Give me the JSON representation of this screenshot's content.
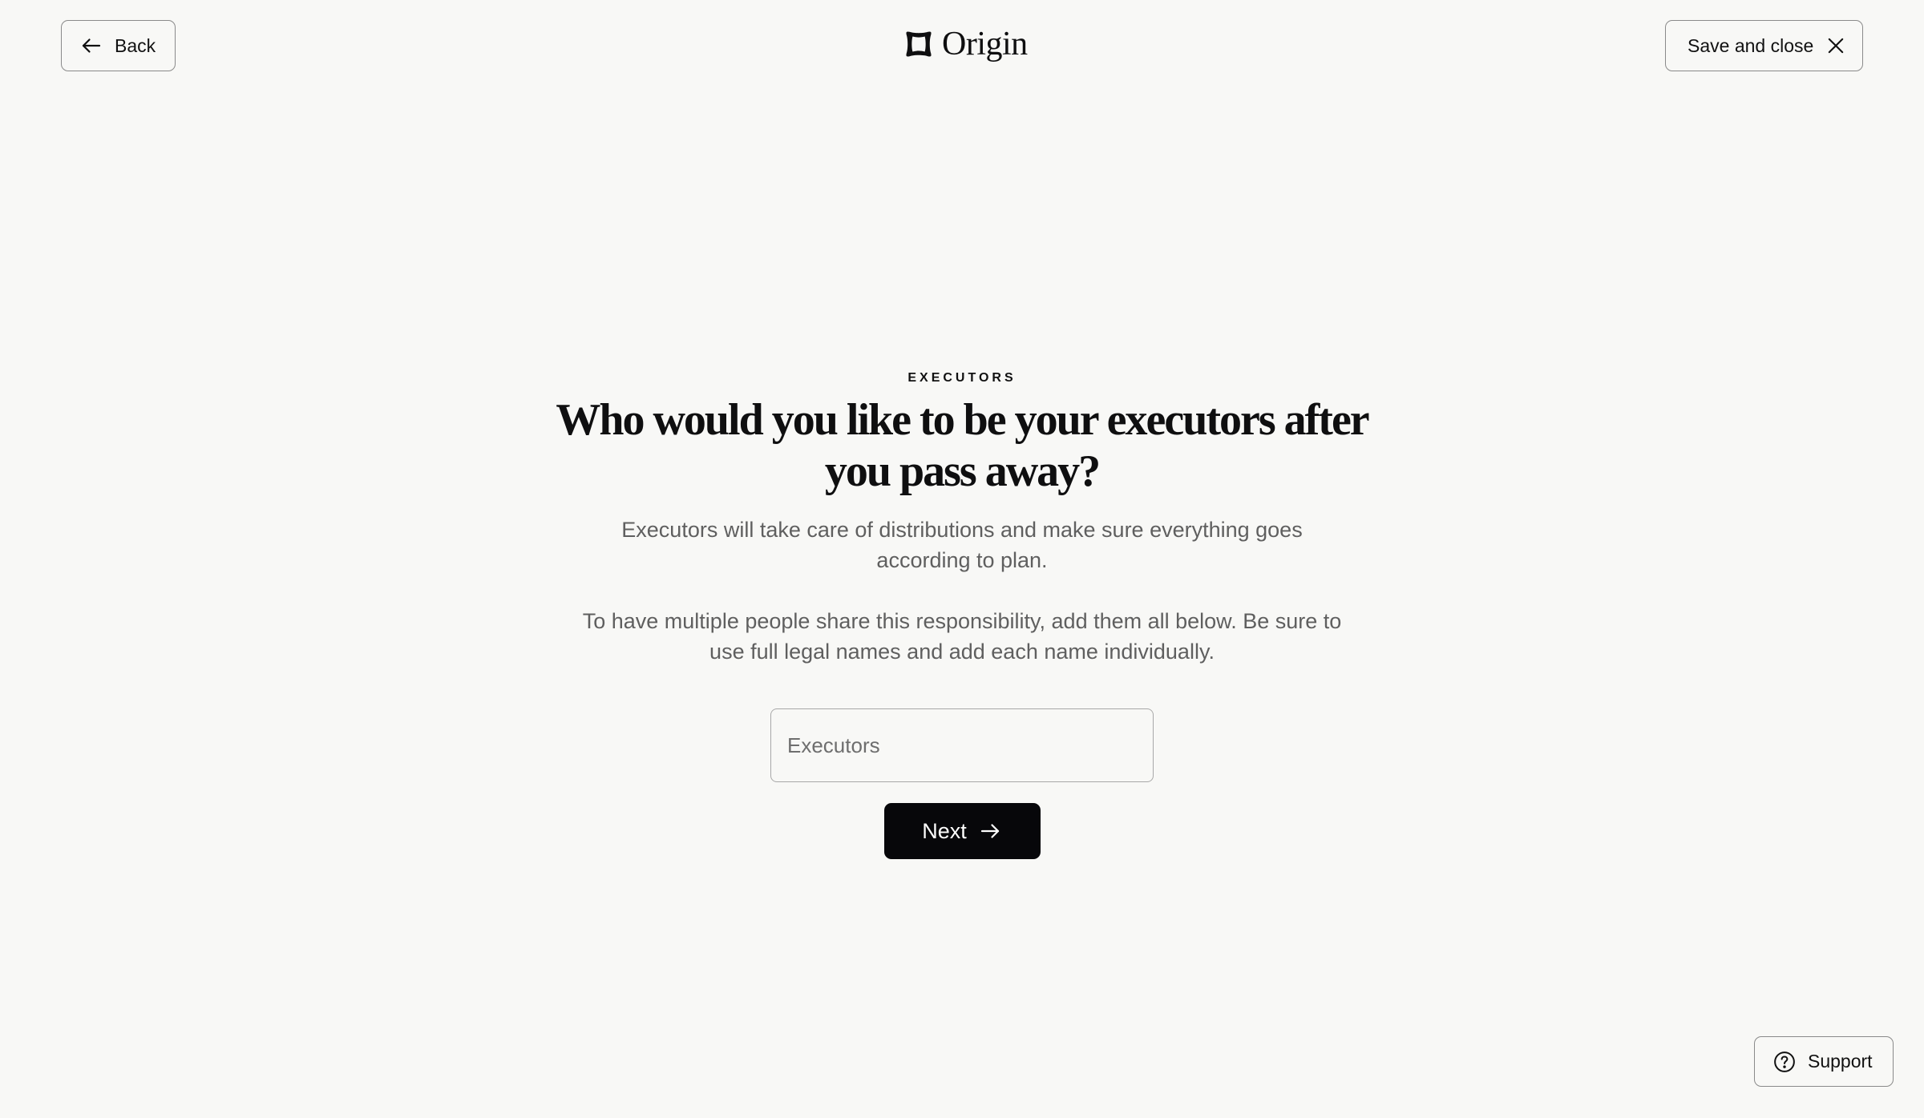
{
  "header": {
    "back_label": "Back",
    "logo_text": "Origin",
    "save_close_label": "Save and close"
  },
  "main": {
    "eyebrow": "EXECUTORS",
    "headline": "Who would you like to be your executors after you pass away?",
    "description_1": "Executors will take care of distributions and make sure everything goes according to plan.",
    "description_2": "To have multiple people share this responsibility, add them all below. Be sure to use full legal names and add each name individually.",
    "executors_input": {
      "placeholder": "Executors",
      "value": ""
    },
    "next_label": "Next"
  },
  "support": {
    "label": "Support"
  },
  "icons": {
    "back": "arrow-left-icon",
    "close": "close-icon",
    "next": "arrow-right-icon",
    "support": "help-circle-icon",
    "logo": "origin-logo-icon"
  },
  "colors": {
    "background": "#f8f8f6",
    "primary_button": "#07070a",
    "body_text": "#5f5f5f"
  }
}
